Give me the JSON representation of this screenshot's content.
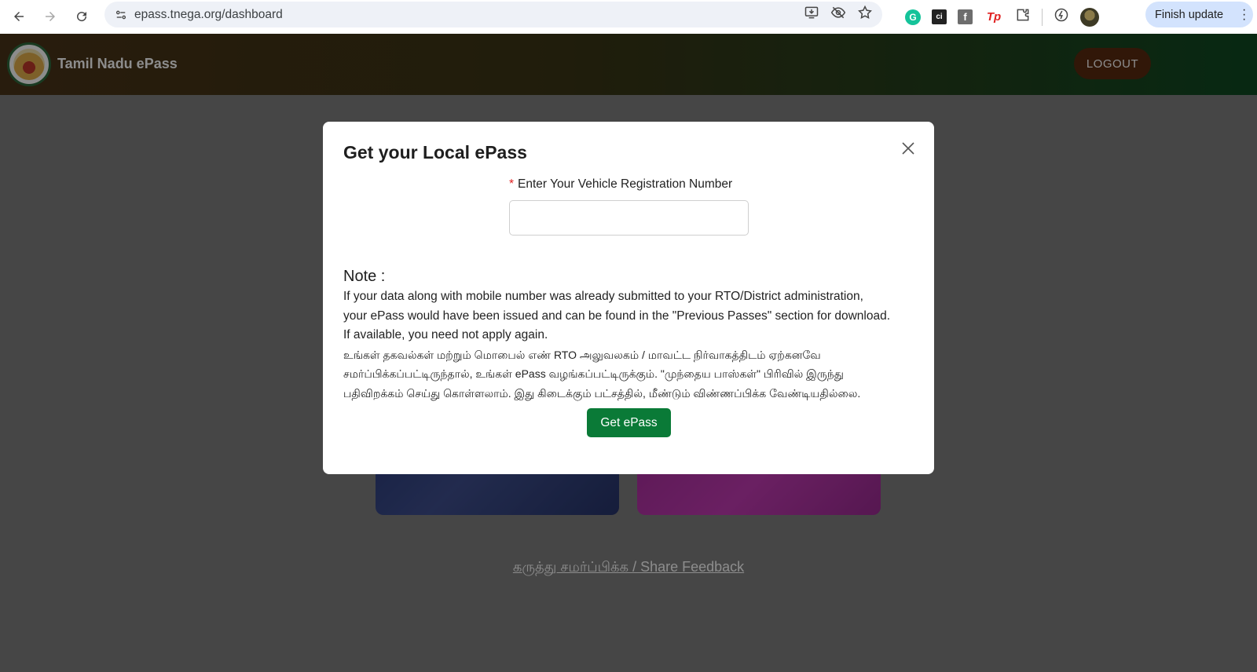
{
  "browser": {
    "url": "epass.tnega.org/dashboard",
    "finish_update_label": "Finish update",
    "extensions": {
      "grammarly": "G",
      "ci": "ci",
      "facebook": "f",
      "tp": "Tp"
    }
  },
  "header": {
    "site_title": "Tamil Nadu ePass",
    "logout_label": "LOGOUT"
  },
  "page": {
    "feedback_link": "கருத்து சமர்ப்பிக்க / Share Feedback"
  },
  "modal": {
    "title": "Get your Local ePass",
    "field_required_mark": "*",
    "field_label": "Enter Your Vehicle Registration Number",
    "field_value": "",
    "note_heading": "Note :",
    "note_lines": [
      "If your data along with mobile number was already submitted to your RTO/District administration,",
      "your ePass would have been issued and can be found in the \"Previous Passes\" section for download.",
      "If available, you need not apply again.",
      "உங்கள் தகவல்கள் மற்றும் மொபைல் எண் RTO அலுவலகம் / மாவட்ட நிர்வாகத்திடம் ஏற்கனவே",
      "சமர்ப்பிக்கப்பட்டிருந்தால், உங்கள் ePass வழங்கப்பட்டிருக்கும். \"முந்தைய பாஸ்கள்\" பிரிவில் இருந்து",
      "பதிவிறக்கம் செய்து கொள்ளலாம். இது கிடைக்கும் பட்சத்தில், மீண்டும் விண்ணப்பிக்க வேண்டியதில்லை."
    ],
    "submit_label": "Get ePass"
  },
  "colors": {
    "primary_green": "#0a7a37",
    "logout_bg": "#5a2a10",
    "required_red": "#e02020",
    "update_chip": "#d3e3fd"
  }
}
